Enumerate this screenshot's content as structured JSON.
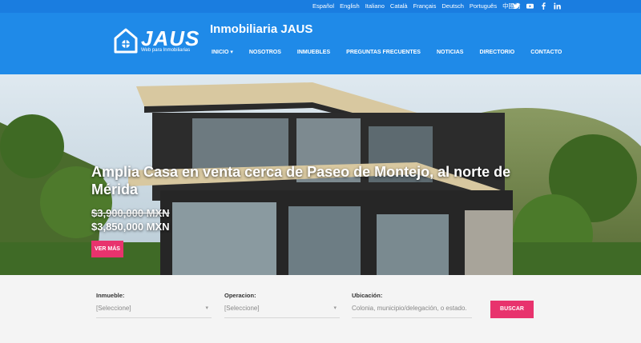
{
  "topbar": {
    "languages": [
      "Español",
      "English",
      "Italiano",
      "Català",
      "Français",
      "Deutsch",
      "Português",
      "中國的"
    ],
    "social_icons": [
      "twitter-icon",
      "youtube-icon",
      "facebook-icon",
      "linkedin-icon"
    ]
  },
  "header": {
    "logo_word": "JAUS",
    "logo_tagline": "Web para Inmobiliarias",
    "site_title": "Inmobiliaria JAUS",
    "nav": [
      "INICIO",
      "NOSOTROS",
      "INMUEBLES",
      "PREGUNTAS FRECUENTES",
      "NOTICIAS",
      "DIRECTORIO",
      "CONTACTO"
    ],
    "active_nav": "INICIO"
  },
  "hero": {
    "title": "Amplia Casa en venta cerca de Paseo de Montejo, al norte de Mérida",
    "price_old": "$3,900,000 MXN",
    "price_new": "$3,850,000 MXN",
    "button": "VER MÁS"
  },
  "search": {
    "inmueble_label": "Inmueble:",
    "inmueble_value": "[Seleccione]",
    "operacion_label": "Operacion:",
    "operacion_value": "[Seleccione]",
    "ubicacion_label": "Ubicación:",
    "ubicacion_placeholder": "Colonia, municipio/delegación, o estado.",
    "button": "BUSCAR"
  },
  "colors": {
    "topbar": "#1a7de0",
    "header": "#1f8ae8",
    "accent": "#e8336d"
  }
}
